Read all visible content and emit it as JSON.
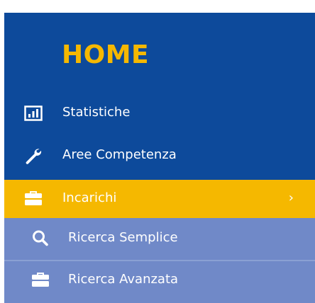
{
  "sidebar": {
    "title": "HOME",
    "items": [
      {
        "label": "Statistiche",
        "icon": "bar-chart-icon"
      },
      {
        "label": "Aree Competenza",
        "icon": "wrench-icon"
      },
      {
        "label": "Incarichi",
        "icon": "briefcase-icon",
        "active": true,
        "chevron": "›"
      }
    ],
    "submenu": [
      {
        "label": "Ricerca Semplice",
        "icon": "search-icon"
      },
      {
        "label": "Ricerca Avanzata",
        "icon": "briefcase-icon"
      }
    ]
  },
  "colors": {
    "sidebar_bg": "#0d4a9b",
    "accent": "#f5b800",
    "submenu_bg": "#7089c8",
    "text": "#ffffff"
  }
}
